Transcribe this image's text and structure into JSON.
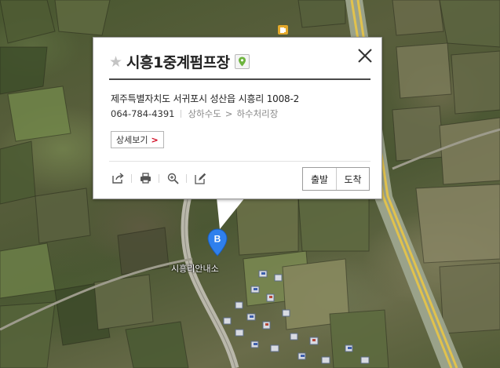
{
  "place": {
    "title": "시흥1중계펌프장",
    "address": "제주특별자치도 서귀포시 성산읍 시흥리 1008-2",
    "phone": "064-784-4391",
    "category_parent": "상하수도",
    "category_arrow": ">",
    "category_child": "하수처리장",
    "detail_label": "상세보기",
    "detail_arrow": ">"
  },
  "route": {
    "start_label": "출발",
    "arrive_label": "도착"
  },
  "map": {
    "marker_letter": "B",
    "marker_color": "#2f80ed",
    "label": "시흥리안내소",
    "road_color": "#d8c25c"
  },
  "icons": {
    "favorite": "star-icon",
    "pin_badge": "map-pin-icon",
    "close": "close-icon",
    "tools": [
      "share-icon",
      "print-icon",
      "zoom-in-icon",
      "edit-icon"
    ]
  }
}
